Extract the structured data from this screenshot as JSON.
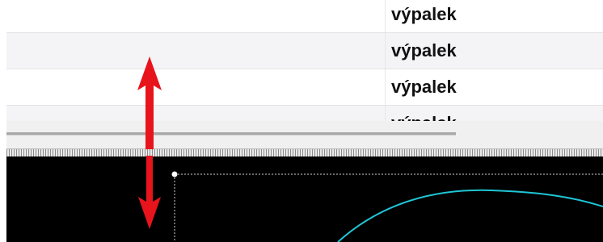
{
  "table": {
    "rows": [
      {
        "label": "výpalek"
      },
      {
        "label": "výpalek"
      },
      {
        "label": "výpalek"
      },
      {
        "label": "výpalek"
      }
    ]
  },
  "colors": {
    "arrow": "#e8141b",
    "curve": "#1fc6d6",
    "canvas_bg": "#000000",
    "selection_dots": "#ffffff"
  },
  "icons": {
    "splitter_handle": "resize-vertical-arrow-icon"
  }
}
